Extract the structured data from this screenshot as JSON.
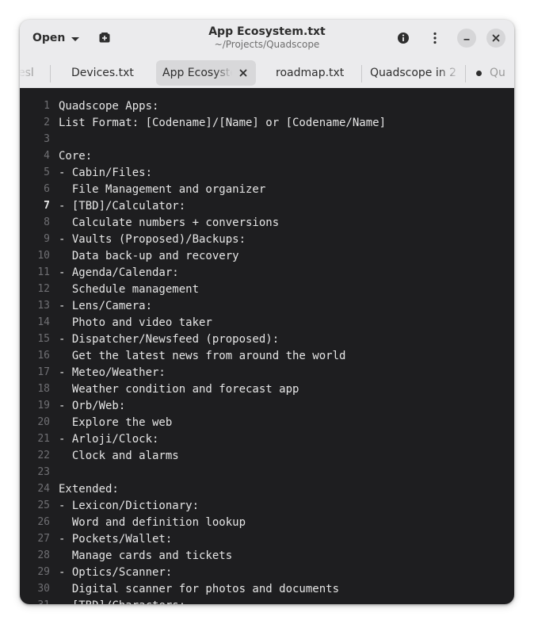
{
  "header": {
    "open_label": "Open",
    "title": "App Ecosystem.txt",
    "subtitle": "~/Projects/Quadscope"
  },
  "tabs": [
    {
      "label": "esl",
      "state": "cut-off-left"
    },
    {
      "label": "Devices.txt",
      "state": "normal"
    },
    {
      "label": "App Ecosystem.txt",
      "state": "active"
    },
    {
      "label": "roadmap.txt",
      "state": "normal"
    },
    {
      "label": "Quadscope in 2",
      "state": "normal"
    },
    {
      "label": "Qu",
      "state": "modified-cut-off-right"
    }
  ],
  "editor": {
    "current_line": 7,
    "lines": [
      "Quadscope Apps:",
      "List Format: [Codename]/[Name] or [Codename/Name]",
      "",
      "Core:",
      "- Cabin/Files:",
      "  File Management and organizer",
      "- [TBD]/Calculator:",
      "  Calculate numbers + conversions",
      "- Vaults (Proposed)/Backups:",
      "  Data back-up and recovery",
      "- Agenda/Calendar:",
      "  Schedule management",
      "- Lens/Camera:",
      "  Photo and video taker",
      "- Dispatcher/Newsfeed (proposed):",
      "  Get the latest news from around the world",
      "- Meteo/Weather:",
      "  Weather condition and forecast app",
      "- Orb/Web:",
      "  Explore the web",
      "- Arloji/Clock:",
      "  Clock and alarms",
      "",
      "Extended:",
      "- Lexicon/Dictionary:",
      "  Word and definition lookup",
      "- Pockets/Wallet:",
      "  Manage cards and tickets",
      "- Optics/Scanner:",
      "  Digital scanner for photos and documents",
      "  [TBD]/Characters:"
    ]
  },
  "icons": {
    "new_tab": "new-tab-icon",
    "info": "info-icon",
    "menu": "vertical-dots-icon",
    "minimize": "minimize-icon",
    "close": "close-icon"
  },
  "colors": {
    "editor_bg": "#1e1e20",
    "header_bg": "#ebebed",
    "active_tab_bg": "#d8d8da"
  }
}
